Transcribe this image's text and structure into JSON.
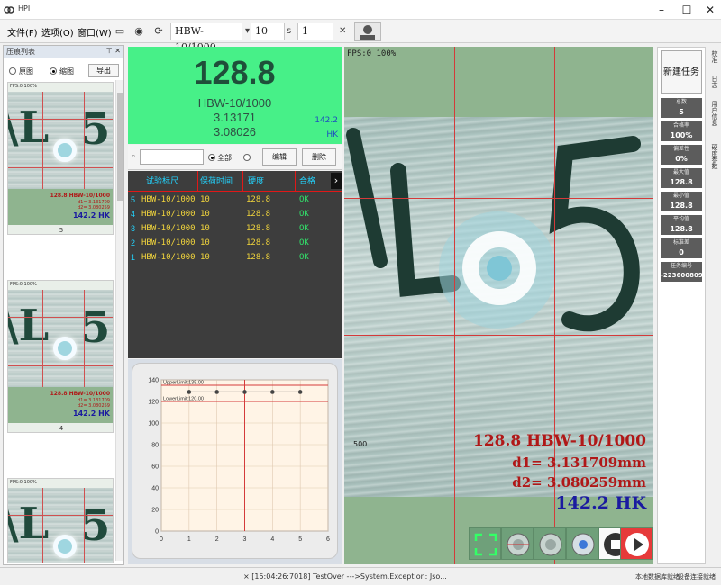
{
  "window": {
    "title": "HPI"
  },
  "menu": {
    "file": "文件(F)",
    "options": "选项(O)",
    "window": "窗口(W)"
  },
  "toolbar": {
    "standard_value": "HBW-10/1000",
    "dwell_value": "10",
    "unit": "s",
    "count_value": "1"
  },
  "left_panel": {
    "title": "压痕列表",
    "radio_original": "原图",
    "radio_thumbnail": "缩图",
    "export_button": "导出",
    "thumbnails": [
      {
        "fps": "FPS:0 100%",
        "result_line": "128.8 HBW-10/1000",
        "d1": "d1= 3.131709",
        "d2": "d2= 3.080259",
        "hk": "142.2 HK",
        "index": "5"
      },
      {
        "fps": "FPS:0 100%",
        "result_line": "128.8 HBW-10/1000",
        "d1": "d1= 3.131709",
        "d2": "d2= 3.080259",
        "hk": "142.2 HK",
        "index": "4"
      },
      {
        "fps": "FPS:0 100%",
        "result_line": "",
        "d1": "",
        "d2": "",
        "hk": "",
        "index": ""
      }
    ]
  },
  "result": {
    "hardness": "128.8",
    "standard": "HBW-10/1000",
    "d1": "3.13171",
    "d2": "3.08026",
    "hk_value": "142.2",
    "hk_unit": "HK"
  },
  "filter": {
    "radio_all": "全部",
    "edit_button": "编辑",
    "delete_button": "删除"
  },
  "table": {
    "columns": [
      "试验标尺",
      "保荷时间",
      "硬度",
      "合格"
    ],
    "rows": [
      {
        "idx": "5",
        "scale": "HBW-10/1000",
        "time": "10",
        "hardness": "128.8",
        "pass": "OK"
      },
      {
        "idx": "4",
        "scale": "HBW-10/1000",
        "time": "10",
        "hardness": "128.8",
        "pass": "OK"
      },
      {
        "idx": "3",
        "scale": "HBW-10/1000",
        "time": "10",
        "hardness": "128.8",
        "pass": "OK"
      },
      {
        "idx": "2",
        "scale": "HBW-10/1000",
        "time": "10",
        "hardness": "128.8",
        "pass": "OK"
      },
      {
        "idx": "1",
        "scale": "HBW-10/1000",
        "time": "10",
        "hardness": "128.8",
        "pass": "OK"
      }
    ]
  },
  "chart_data": {
    "type": "line",
    "x": [
      1,
      2,
      3,
      4,
      5
    ],
    "series": [
      {
        "values": [
          128.8,
          128.8,
          128.8,
          128.8,
          128.8
        ]
      }
    ],
    "xlim": [
      0,
      6
    ],
    "ylim": [
      0,
      140
    ],
    "xticks": [
      "0",
      "1",
      "2",
      "3",
      "4",
      "5",
      "6"
    ],
    "yticks": [
      "0",
      "20",
      "40",
      "60",
      "80",
      "100",
      "120",
      "140"
    ],
    "upper_limit_label": "UpperLimit:135.00",
    "upper_limit": 135,
    "lower_limit_label": "LowerLimit:120.00",
    "lower_limit": 120,
    "marker_x": 3,
    "grid": true,
    "colors": {
      "line": "#555555",
      "limit": "#d43a3a",
      "bg": "#fff4e6"
    }
  },
  "camera": {
    "fps": "FPS:0 100%",
    "scale_label": "500",
    "result_line": "128.8 HBW-10/1000",
    "d1": "d1= 3.131709mm",
    "d2": "d2= 3.080259mm",
    "hk": "142.2 HK"
  },
  "stats": {
    "new_task": "新建任务",
    "items": [
      {
        "label": "总数",
        "value": "5"
      },
      {
        "label": "合格率",
        "value": "100%"
      },
      {
        "label": "偏差性",
        "value": "0%"
      },
      {
        "label": "最大值",
        "value": "128.8"
      },
      {
        "label": "最小值",
        "value": "128.8"
      },
      {
        "label": "平均值",
        "value": "128.8"
      },
      {
        "label": "标准差",
        "value": "0"
      },
      {
        "label": "任务编号",
        "value": "-223600809"
      }
    ]
  },
  "vtabs": [
    "校准",
    "日志",
    "用户信息",
    "硬度参数"
  ],
  "status": {
    "message": "× [15:04:26:7018] TestOver --->System.Exception: Jso...",
    "db": "本地数据库就绪",
    "device": "设备连接就绪"
  }
}
